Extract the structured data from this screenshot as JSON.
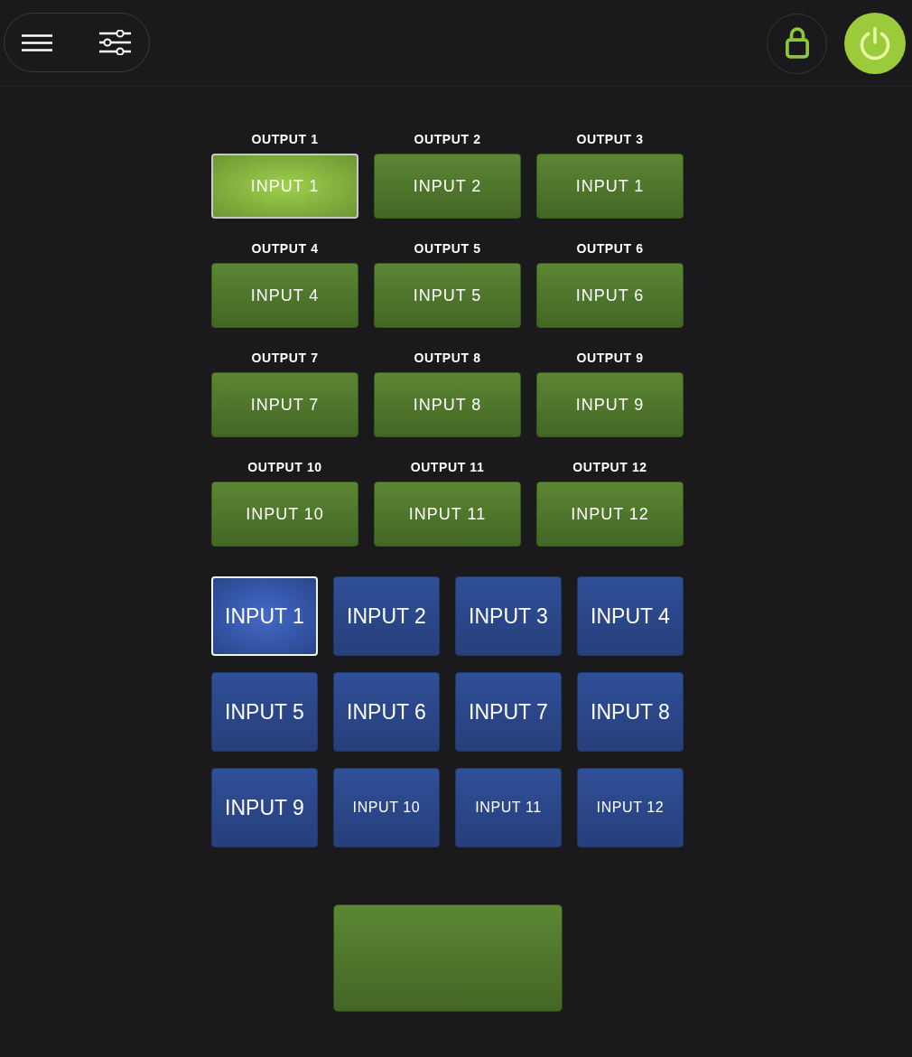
{
  "toolbar": {
    "lock": {
      "locked": true
    },
    "power": {
      "on": true
    }
  },
  "outputs": [
    {
      "label": "OUTPUT 1",
      "source": "INPUT 1",
      "selected": true
    },
    {
      "label": "OUTPUT 2",
      "source": "INPUT 2",
      "selected": false
    },
    {
      "label": "OUTPUT 3",
      "source": "INPUT 1",
      "selected": false
    },
    {
      "label": "OUTPUT 4",
      "source": "INPUT 4",
      "selected": false
    },
    {
      "label": "OUTPUT 5",
      "source": "INPUT 5",
      "selected": false
    },
    {
      "label": "OUTPUT 6",
      "source": "INPUT 6",
      "selected": false
    },
    {
      "label": "OUTPUT 7",
      "source": "INPUT 7",
      "selected": false
    },
    {
      "label": "OUTPUT 8",
      "source": "INPUT 8",
      "selected": false
    },
    {
      "label": "OUTPUT 9",
      "source": "INPUT 9",
      "selected": false
    },
    {
      "label": "OUTPUT 10",
      "source": "INPUT 10",
      "selected": false
    },
    {
      "label": "OUTPUT 11",
      "source": "INPUT 11",
      "selected": false
    },
    {
      "label": "OUTPUT 12",
      "source": "INPUT 12",
      "selected": false
    }
  ],
  "inputs": [
    {
      "label": "INPUT 1",
      "kind": "large",
      "selected": true
    },
    {
      "label": "INPUT 2",
      "kind": "large",
      "selected": false
    },
    {
      "label": "INPUT 3",
      "kind": "large",
      "selected": false
    },
    {
      "label": "INPUT 4",
      "kind": "large",
      "selected": false
    },
    {
      "label": "INPUT 5",
      "kind": "large",
      "selected": false
    },
    {
      "label": "INPUT 6",
      "kind": "large",
      "selected": false
    },
    {
      "label": "INPUT 7",
      "kind": "large",
      "selected": false
    },
    {
      "label": "INPUT 8",
      "kind": "large",
      "selected": false
    },
    {
      "label": "INPUT 9",
      "kind": "large",
      "selected": false
    },
    {
      "label": "INPUT 10",
      "kind": "small",
      "selected": false
    },
    {
      "label": "INPUT 11",
      "kind": "small",
      "selected": false
    },
    {
      "label": "INPUT 12",
      "kind": "small",
      "selected": false
    }
  ]
}
